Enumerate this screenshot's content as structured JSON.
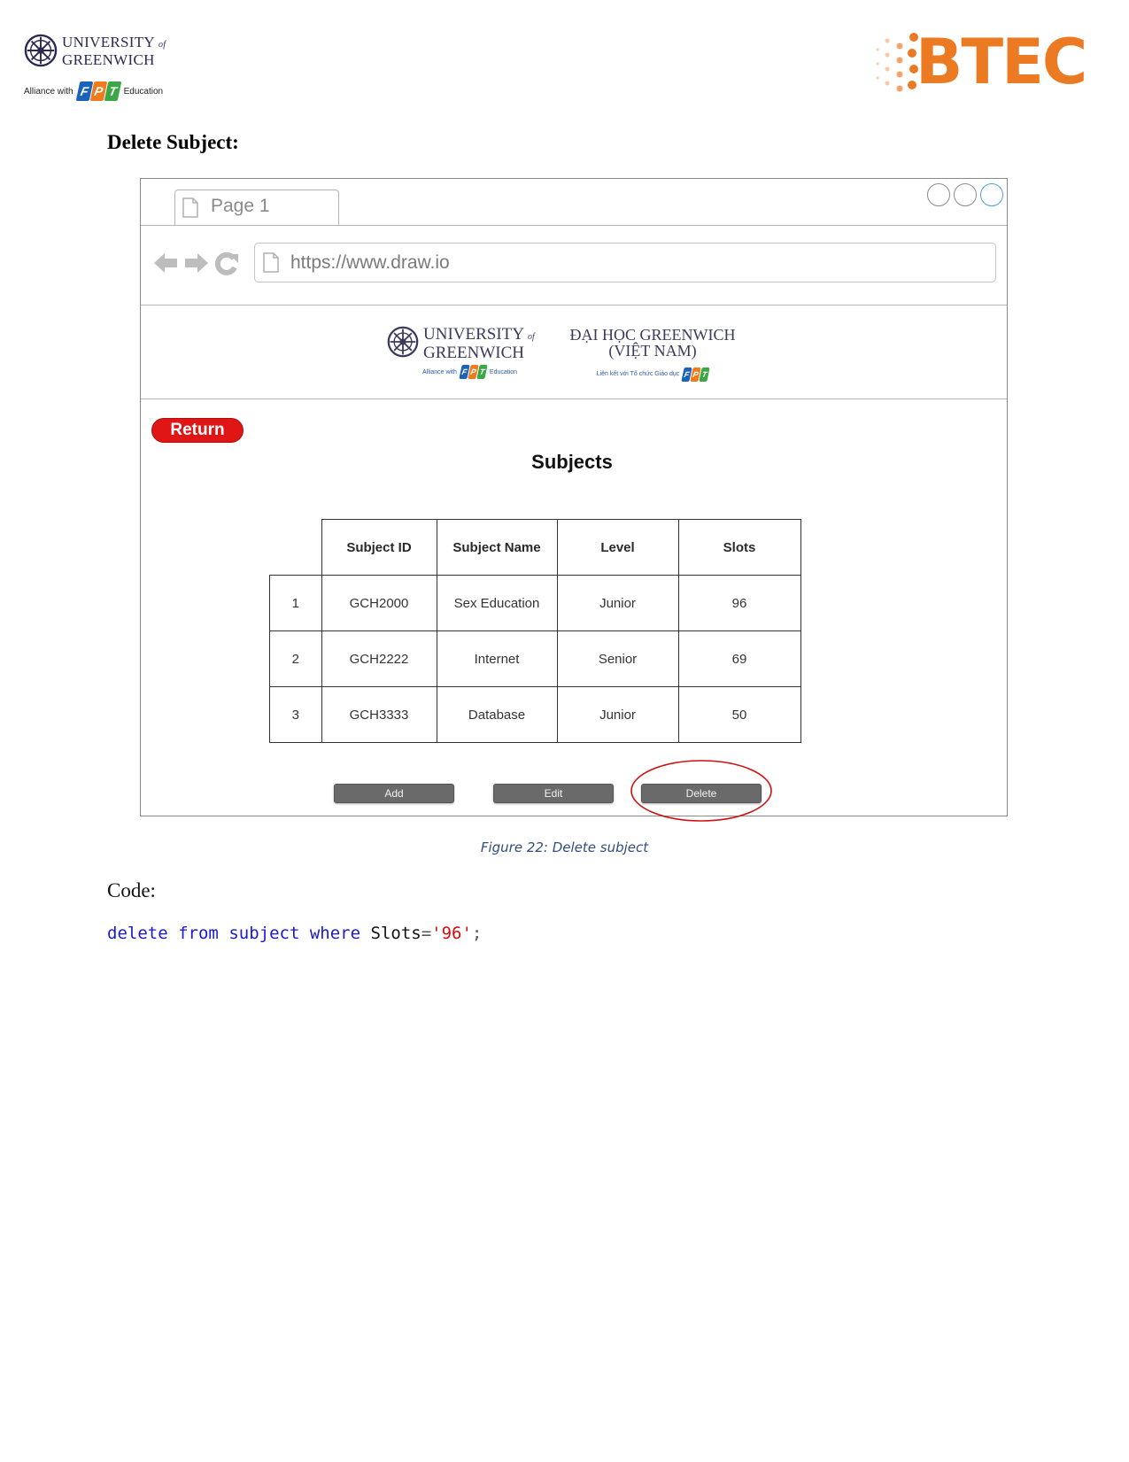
{
  "header": {
    "left_logo": {
      "line1": "UNIVERSITY",
      "of": "of",
      "line2": "GREENWICH",
      "alliance_prefix": "Alliance with",
      "fpt_letters": [
        "F",
        "P",
        "T"
      ],
      "alliance_suffix": "Education"
    },
    "right_logo": {
      "text": "BTEC",
      "color": "#ec7a22"
    }
  },
  "section_title": "Delete Subject:",
  "mockup": {
    "tab_label": "Page 1",
    "url": "https://www.draw.io",
    "banner": {
      "uog_line1": "UNIVERSITY",
      "uog_of": "of",
      "uog_line2": "GREENWICH",
      "uog_sub_prefix": "Alliance with",
      "uog_sub_suffix": "Education",
      "vn_line1": "ĐẠI HỌC GREENWICH",
      "vn_line2": "(VIỆT NAM)",
      "vn_sub": "Liên kết với Tổ chức Giáo dục"
    },
    "return_label": "Return",
    "heading": "Subjects",
    "table": {
      "columns": [
        "",
        "Subject ID",
        "Subject Name",
        "Level",
        "Slots"
      ],
      "rows": [
        [
          "1",
          "GCH2000",
          "Sex Education",
          "Junior",
          "96"
        ],
        [
          "2",
          "GCH2222",
          "Internet",
          "Senior",
          "69"
        ],
        [
          "3",
          "GCH3333",
          "Database",
          "Junior",
          "50"
        ]
      ]
    },
    "buttons": {
      "add": "Add",
      "edit": "Edit",
      "delete": "Delete"
    },
    "highlighted_button": "Delete",
    "highlight_color": "#d01010",
    "return_color": "#e01616"
  },
  "caption": "Figure 22: Delete subject",
  "code_label": "Code:",
  "code": {
    "kw1": "delete",
    "kw2": "from",
    "kw3": "subject",
    "kw4": "where",
    "ident": "Slots",
    "op": "=",
    "value": "'96'",
    "end": ";"
  }
}
